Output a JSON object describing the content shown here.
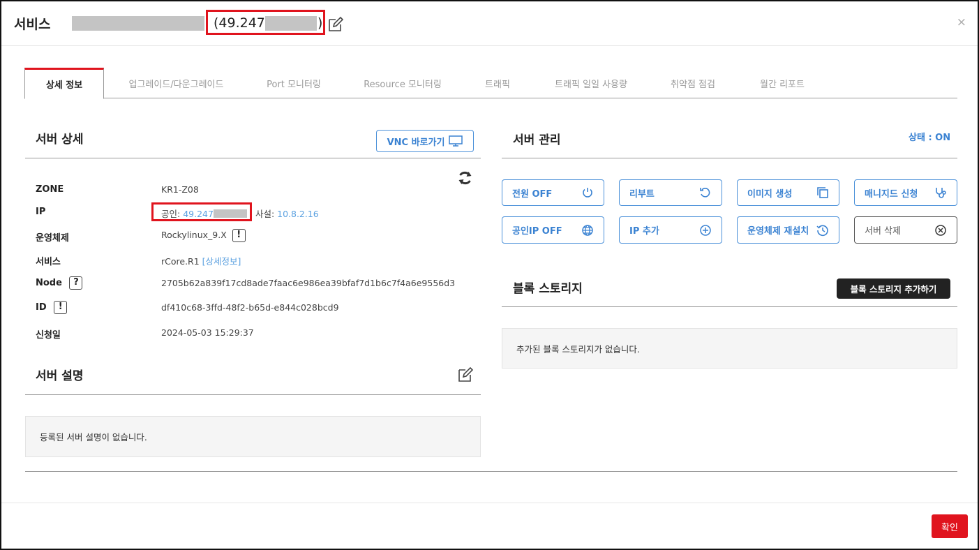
{
  "header": {
    "title": "서비스",
    "ip_visible": "(49.247.",
    "paren_close": ")",
    "close_label": "×"
  },
  "tabs": [
    {
      "label": "상세 정보",
      "active": true
    },
    {
      "label": "업그레이드/다운그레이드"
    },
    {
      "label": "Port 모니터링"
    },
    {
      "label": "Resource 모니터링"
    },
    {
      "label": "트래픽"
    },
    {
      "label": "트래픽 일일 사용량"
    },
    {
      "label": "취약점 점검"
    },
    {
      "label": "월간 리포트"
    }
  ],
  "server_detail": {
    "title": "서버 상세",
    "vnc_label": "VNC 바로가기",
    "rows": {
      "zone_label": "ZONE",
      "zone_value": "KR1-Z08",
      "ip_label": "IP",
      "ip_public_prefix": "공인: ",
      "ip_public": "49.247",
      "ip_private_prefix": "사설: ",
      "ip_private": "10.8.2.16",
      "os_label": "운영체제",
      "os_value": "Rockylinux_9.X",
      "service_label": "서비스",
      "service_value": "rCore.R1",
      "service_link": "[상세정보]",
      "node_label": "Node",
      "node_value": "2705b62a839f17cd8ade7faac6e986ea39bfaf7d1b6c7f4a6e9556d3",
      "id_label": "ID",
      "id_value": "df410c68-3ffd-48f2-b65d-e844c028bcd9",
      "date_label": "신청일",
      "date_value": "2024-05-03 15:29:37",
      "badge_excl": "!",
      "badge_q": "?"
    }
  },
  "server_desc": {
    "title": "서버 설명",
    "empty": "등록된 서버 설명이 없습니다."
  },
  "server_mgmt": {
    "title": "서버 관리",
    "status": "상태 : ON",
    "buttons": [
      "전원 OFF",
      "리부트",
      "이미지 생성",
      "매니지드 신청",
      "공인IP OFF",
      "IP 추가",
      "운영체제 재설치",
      "서버 삭제"
    ]
  },
  "block_storage": {
    "title": "블록 스토리지",
    "add_label": "블록 스토리지 추가하기",
    "empty": "추가된 블록 스토리지가 없습니다."
  },
  "footer": {
    "ok_label": "확인"
  },
  "colors": {
    "accent": "#3a82d2",
    "danger": "#e0141e",
    "dark": "#222222"
  }
}
